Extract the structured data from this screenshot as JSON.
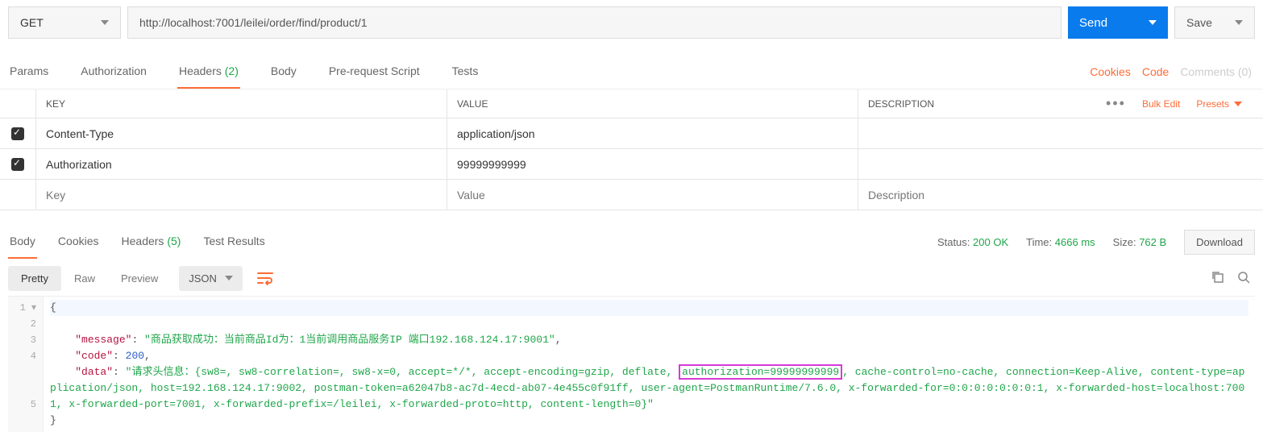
{
  "request": {
    "method": "GET",
    "url": "http://localhost:7001/leilei/order/find/product/1",
    "send_label": "Send",
    "save_label": "Save"
  },
  "tabs": {
    "params": "Params",
    "authorization": "Authorization",
    "headers": "Headers",
    "headers_count": "(2)",
    "body": "Body",
    "pre_request": "Pre-request Script",
    "tests": "Tests"
  },
  "right_links": {
    "cookies": "Cookies",
    "code": "Code",
    "comments": "Comments (0)"
  },
  "headers_table": {
    "col_key": "KEY",
    "col_value": "VALUE",
    "col_desc": "DESCRIPTION",
    "bulk_edit": "Bulk Edit",
    "presets": "Presets",
    "rows": [
      {
        "checked": true,
        "key": "Content-Type",
        "value": "application/json",
        "desc": ""
      },
      {
        "checked": true,
        "key": "Authorization",
        "value": "99999999999",
        "desc": ""
      }
    ],
    "placeholder_key": "Key",
    "placeholder_value": "Value",
    "placeholder_desc": "Description"
  },
  "response": {
    "tabs": {
      "body": "Body",
      "cookies": "Cookies",
      "headers": "Headers",
      "headers_count": "(5)",
      "test_results": "Test Results"
    },
    "status_label": "Status:",
    "status_value": "200 OK",
    "time_label": "Time:",
    "time_value": "4666 ms",
    "size_label": "Size:",
    "size_value": "762 B",
    "download": "Download"
  },
  "body_toolbar": {
    "pretty": "Pretty",
    "raw": "Raw",
    "preview": "Preview",
    "json": "JSON"
  },
  "json_body": {
    "message_key": "\"message\"",
    "message_val": "\"商品获取成功：当前商品Id为：1当前调用商品服务IP 端口192.168.124.17:9001\"",
    "code_key": "\"code\"",
    "code_val": "200",
    "data_key": "\"data\"",
    "data_pre": "\"请求头信息：{sw8=, sw8-correlation=, sw8-x=0, accept=*/*, accept-encoding=gzip, deflate, ",
    "data_hl": "authorization=99999999999",
    "data_post": ", cache-control=no-cache, connection=Keep-Alive, content-type=application/json, host=192.168.124.17:9002, postman-token=a62047b8-ac7d-4ecd-ab07-4e455c0f91ff, user-agent=PostmanRuntime/7.6.0, x-forwarded-for=0:0:0:0:0:0:0:1, x-forwarded-host=localhost:7001, x-forwarded-port=7001, x-forwarded-prefix=/leilei, x-forwarded-proto=http, content-length=0}\""
  }
}
